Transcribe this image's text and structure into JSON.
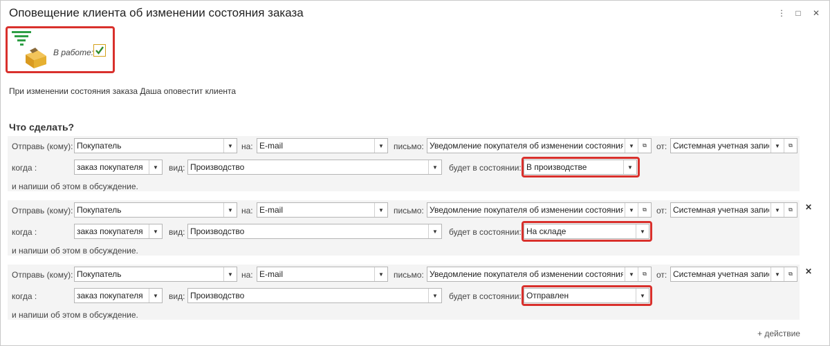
{
  "window": {
    "title": "Оповещение клиента об изменении состояния заказа",
    "menu_icon": "⋮",
    "maximize_icon": "□",
    "close_icon": "✕"
  },
  "status": {
    "in_work_label": "В работе:",
    "in_work_checked": true
  },
  "description": "При изменении состояния заказа Даша оповестит клиента",
  "section_title": "Что сделать?",
  "labels": {
    "send_to": "Отправь (кому):",
    "send_to_first": "Отправь (кому):",
    "on": "на:",
    "letter": "письмо:",
    "from": "от:",
    "when": "когда :",
    "kind": "вид:",
    "will_be_state": "будет в состоянии:",
    "and_write": "и напиши об этом в обсуждение."
  },
  "rules": [
    {
      "recipient": "Покупатель",
      "channel": "E-mail",
      "letter": "Уведомление покупателя об изменении состояния з",
      "sender": "Системная учетная запис",
      "when": "заказ покупателя",
      "kind": "Производство",
      "state": "В производстве",
      "closable": false
    },
    {
      "recipient": "Покупатель",
      "channel": "E-mail",
      "letter": "Уведомление покупателя об изменении состояния з",
      "sender": "Системная учетная запис",
      "when": "заказ покупателя",
      "kind": "Производство",
      "state": "На складе",
      "closable": true
    },
    {
      "recipient": "Покупатель",
      "channel": "E-mail",
      "letter": "Уведомление покупателя об изменении состояния з",
      "sender": "Системная учетная запис",
      "when": "заказ покупателя",
      "kind": "Производство",
      "state": "Отправлен",
      "closable": true
    }
  ],
  "add_action": "+ действие",
  "colors": {
    "highlight": "#d9302c",
    "checkbox_border": "#d4a017",
    "checkmark": "#2e8b2e",
    "logo_green": "#2e9e45",
    "logo_yellow": "#e6b030"
  }
}
